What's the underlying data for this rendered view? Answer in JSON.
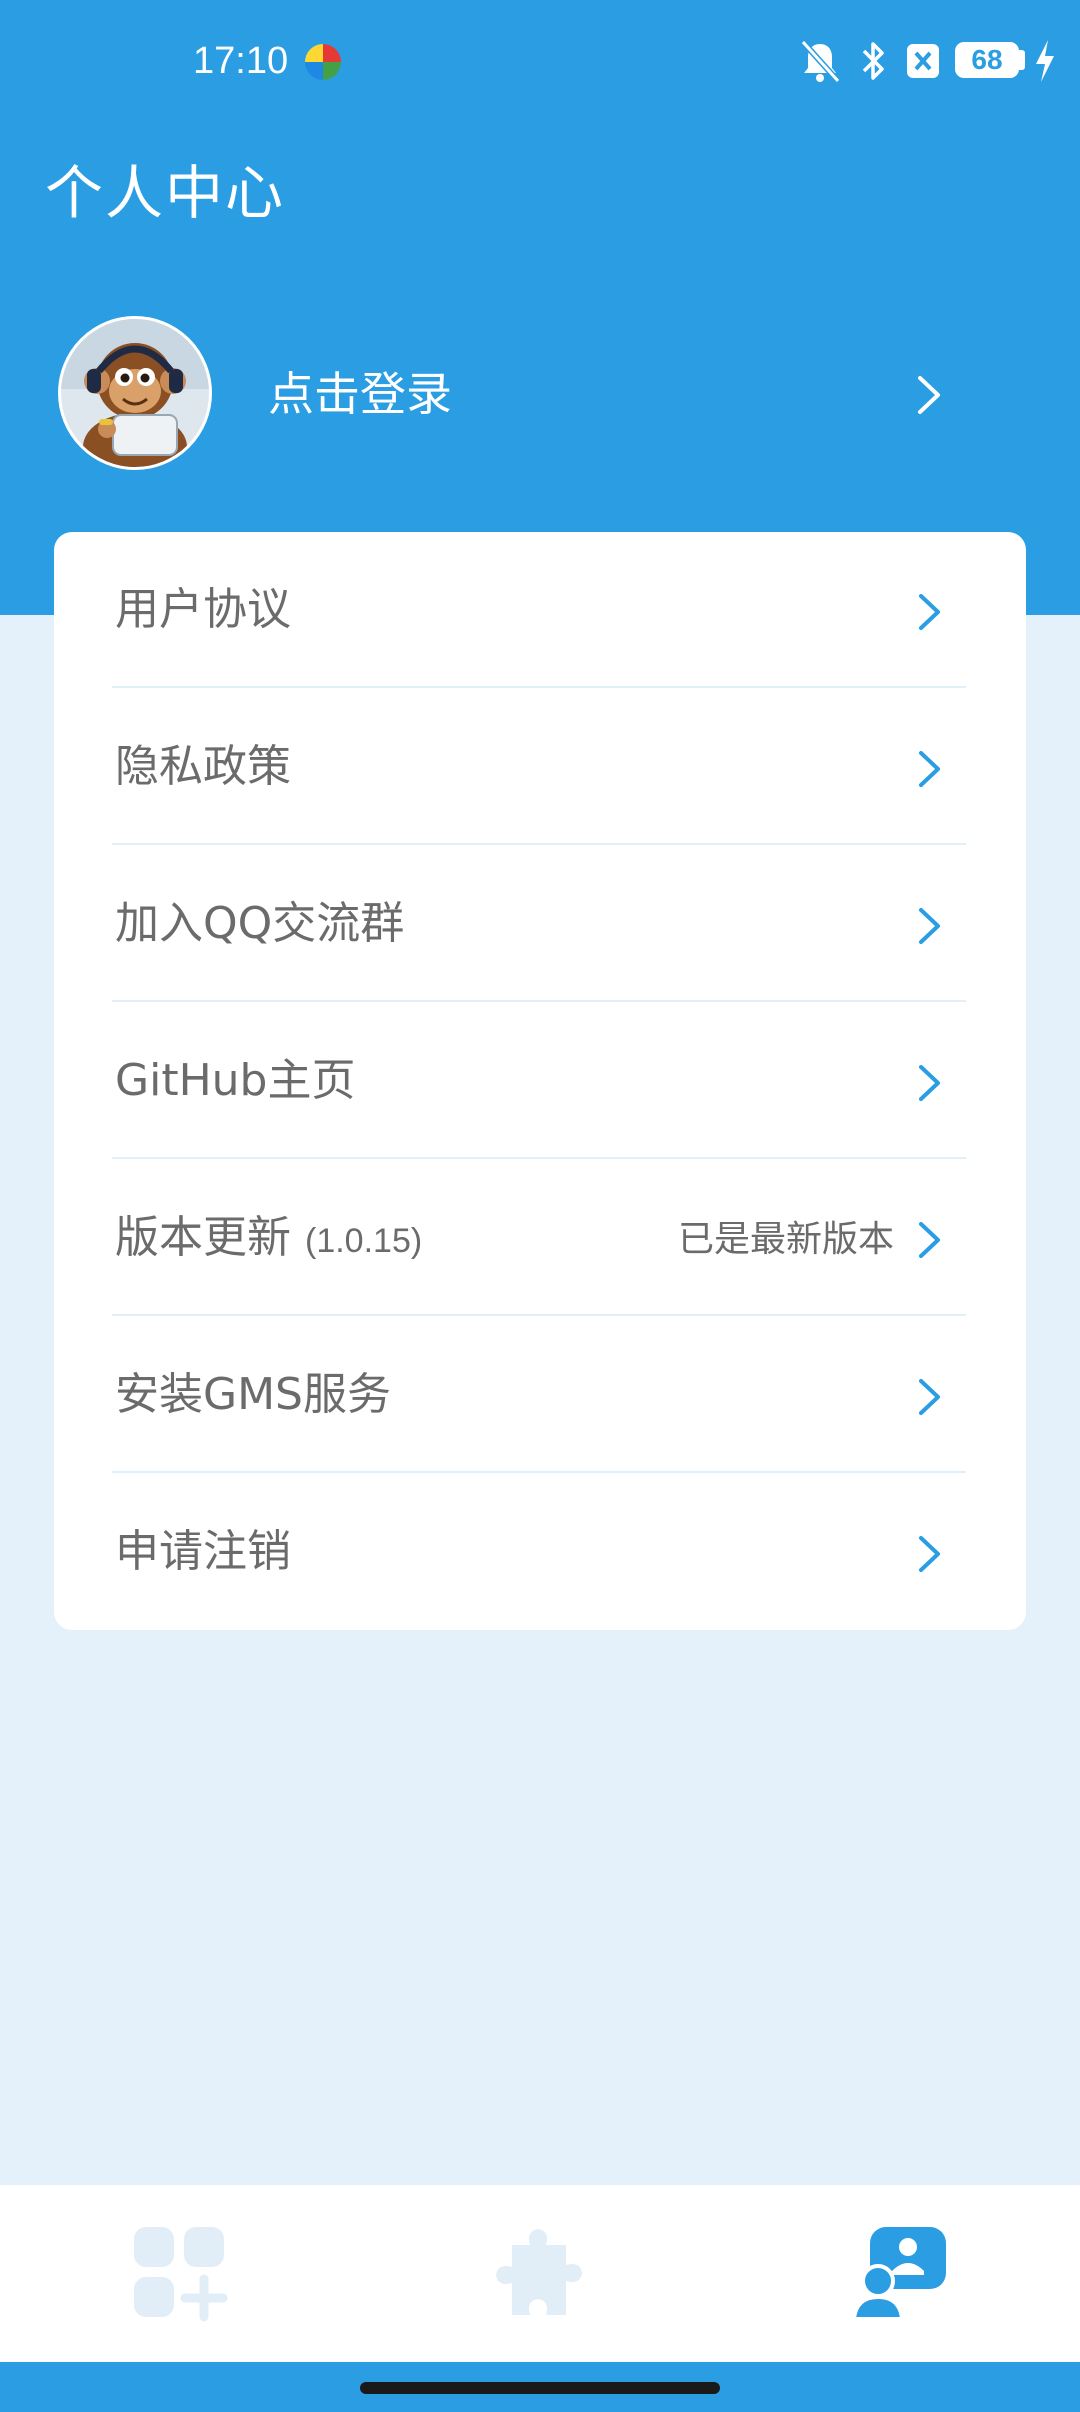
{
  "status_bar": {
    "time": "17:10",
    "battery_level": "68",
    "icons": [
      "app-notification-icon",
      "bell-off-icon",
      "bluetooth-icon",
      "sim-off-icon",
      "battery-icon",
      "charging-bolt-icon"
    ]
  },
  "header": {
    "title": "个人中心"
  },
  "profile": {
    "login_label": "点击登录",
    "avatar_icon": "monkey-avatar"
  },
  "menu": {
    "items": [
      {
        "label": "用户协议"
      },
      {
        "label": "隐私政策"
      },
      {
        "label": "加入QQ交流群"
      },
      {
        "label": "GitHub主页"
      },
      {
        "label": "版本更新",
        "version": "(1.0.15)",
        "status": "已是最新版本"
      },
      {
        "label": "安装GMS服务"
      },
      {
        "label": "申请注销"
      }
    ]
  },
  "bottom_nav": {
    "tabs": [
      {
        "icon": "apps-add-icon",
        "active": false
      },
      {
        "icon": "puzzle-icon",
        "active": false
      },
      {
        "icon": "profile-icon",
        "active": true
      }
    ]
  },
  "colors": {
    "primary": "#2b9de3",
    "page_background": "#e4f1fa",
    "card_background": "#ffffff",
    "text_gray": "#6b6b6b",
    "inactive_icon": "#e1eef8"
  }
}
